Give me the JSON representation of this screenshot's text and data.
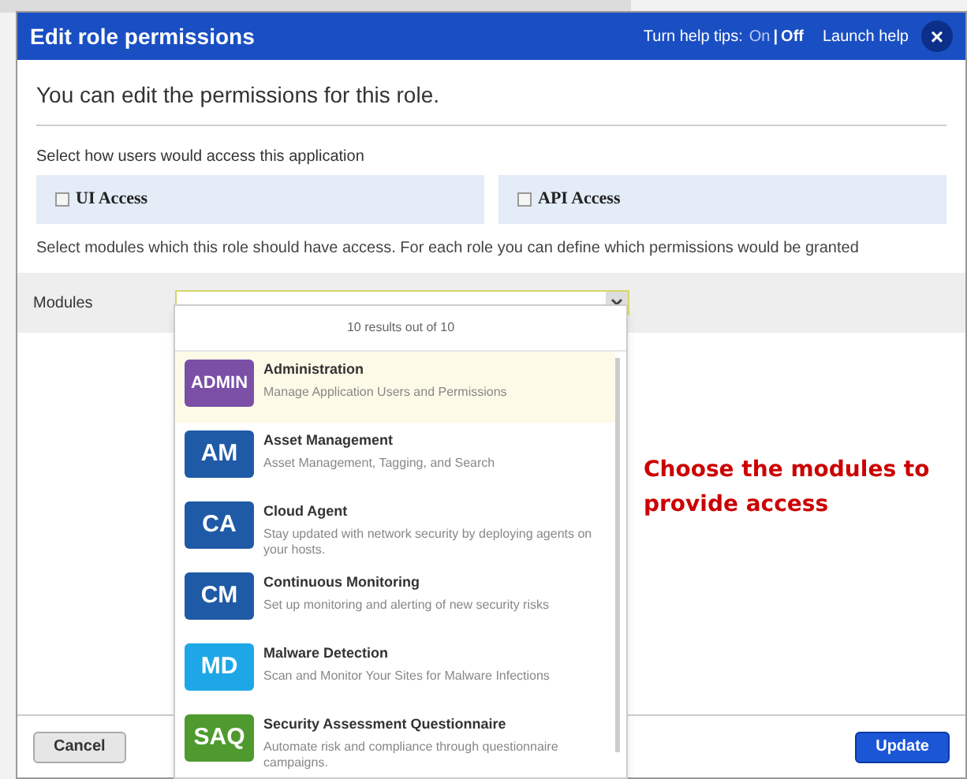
{
  "dialog": {
    "title": "Edit role permissions",
    "help_tips": {
      "label": "Turn help tips:",
      "separator": "|",
      "options": [
        {
          "label": "On",
          "selected": false
        },
        {
          "label": "Off",
          "selected": true
        }
      ]
    },
    "launch_help": "Launch help",
    "close": "×"
  },
  "intro": "You can edit the permissions for this role.",
  "access": {
    "prompt": "Select how users would access this application",
    "options": [
      {
        "label": "UI Access",
        "checked": false
      },
      {
        "label": "API Access",
        "checked": false
      }
    ]
  },
  "modules_prompt": "Select modules which this role should have access. For each role you can define which permissions would be granted",
  "modules": {
    "label": "Modules",
    "dropdown": {
      "count": "10 results out of 10",
      "items": [
        {
          "badge": "ADMIN",
          "color": "#7b4fa6",
          "name": "Administration",
          "description": "Manage Application Users and Permissions",
          "selected": true
        },
        {
          "badge": "AM",
          "color": "#1f5aa6",
          "name": "Asset Management",
          "description": "Asset Management, Tagging, and Search",
          "selected": false
        },
        {
          "badge": "CA",
          "color": "#1f5aa6",
          "name": "Cloud Agent",
          "description": "Stay updated with network security by deploying agents on your hosts.",
          "selected": false
        },
        {
          "badge": "CM",
          "color": "#1f5aa6",
          "name": "Continuous Monitoring",
          "description": "Set up monitoring and alerting of new security risks",
          "selected": false
        },
        {
          "badge": "MD",
          "color": "#1ea7e6",
          "name": "Malware Detection",
          "description": "Scan and Monitor Your Sites for Malware Infections",
          "selected": false
        },
        {
          "badge": "SAQ",
          "color": "#4e9a2e",
          "name": "Security Assessment Questionnaire",
          "description": "Automate risk and compliance through questionnaire campaigns.",
          "selected": false
        }
      ]
    }
  },
  "annotation": "Choose the modules to provide access",
  "buttons": [
    {
      "label": "Cancel",
      "kind": "secondary"
    },
    {
      "label": "Update",
      "kind": "primary"
    }
  ]
}
